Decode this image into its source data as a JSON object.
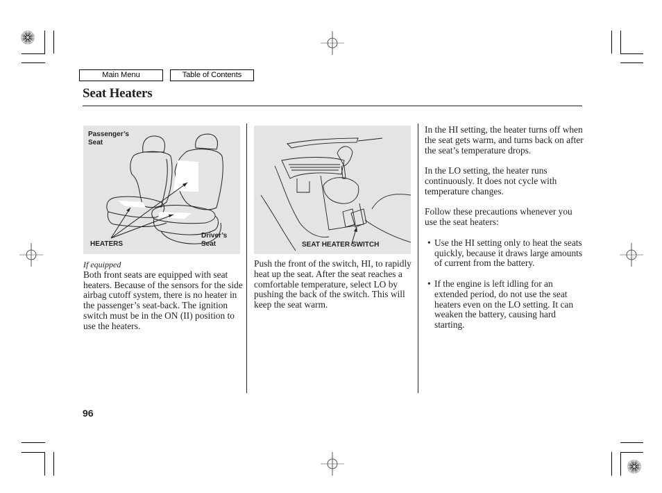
{
  "nav": {
    "main_menu": "Main Menu",
    "table_of_contents": "Table of Contents"
  },
  "page": {
    "title": "Seat Heaters",
    "number": "96"
  },
  "figures": {
    "seats": {
      "label_passenger": "Passenger’s\nSeat",
      "label_passenger_line1": "Passenger’s",
      "label_passenger_line2": "Seat",
      "label_heaters": "HEATERS",
      "label_driver_line1": "Driver’s",
      "label_driver_line2": "Seat"
    },
    "switch": {
      "label": "SEAT HEATER SWITCH"
    }
  },
  "column1": {
    "note": "If equipped",
    "text": "Both front seats are equipped with seat heaters. Because of the sensors for the side airbag cutoff system, there is no heater in the passenger’s seat-back. The ignition switch must be in the ON (II) position to use the heaters."
  },
  "column2": {
    "text": "Push the front of the switch, HI, to rapidly heat up the seat. After the seat reaches a comfortable temperature, select LO by pushing the back of the switch. This will keep the seat warm."
  },
  "column3": {
    "paragraphs": [
      "In the HI setting, the heater turns off when the seat gets warm, and turns back on after the seat’s temperature drops.",
      "In the LO setting, the heater runs continuously. It does not cycle with temperature changes.",
      "Follow these precautions whenever you use the seat heaters:"
    ],
    "bullets": [
      "Use the HI setting only to heat the seats quickly, because it draws large amounts of current from the battery.",
      "If the engine is left idling for an extended period, do not use the seat heaters even on the LO setting. It can weaken the battery, causing hard starting."
    ]
  },
  "icons": {
    "bullet": "•"
  }
}
